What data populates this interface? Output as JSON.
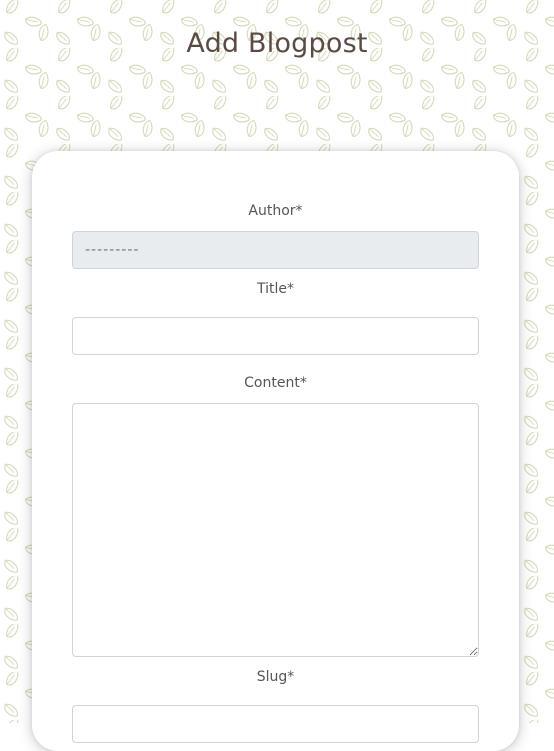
{
  "page": {
    "title": "Add Blogpost"
  },
  "form": {
    "author": {
      "label": "Author*",
      "selected_value": "---------"
    },
    "title": {
      "label": "Title*",
      "value": ""
    },
    "content": {
      "label": "Content*",
      "value": ""
    },
    "slug": {
      "label": "Slug*",
      "value": ""
    }
  },
  "colors": {
    "heading": "#5a4a44",
    "label": "#555555",
    "leaf_pattern": "#d6d8b8",
    "disabled_field_bg": "#e9ecef",
    "field_border": "#ced4da"
  },
  "icons": {
    "background": "leaf-icon"
  }
}
